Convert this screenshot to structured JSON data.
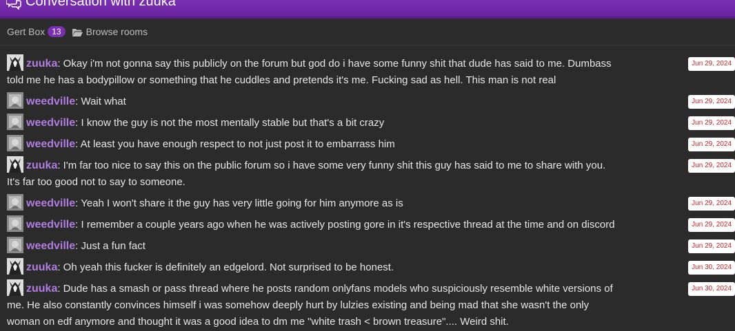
{
  "header": {
    "title": "Conversation with zuuka",
    "icon": "chat-bubbles-icon"
  },
  "subnav": {
    "box_label": "Gert Box",
    "box_count": "13",
    "browse_label": "Browse rooms",
    "browse_icon": "folder-open-icon"
  },
  "colors": {
    "header": "#7a2fb0",
    "username": "#b07ce0",
    "timestamp_text": "#cc2222",
    "background": "#2b2b2b"
  },
  "messages": [
    {
      "user": "zuuka",
      "avatar": "zuuka",
      "text": ": Okay i'm not gonna say this publicly on the forum but god do i have some funny shit that dude has said to me. Dumbass told me he has a bodypillow or something that he cuddles and pretends it's me. Fucking sad as hell. This man is not real",
      "time": "Jun 29, 2024"
    },
    {
      "user": "weedville",
      "avatar": "weedville",
      "text": ": Wait what",
      "time": "Jun 29, 2024"
    },
    {
      "user": "weedville",
      "avatar": "weedville",
      "text": ": I know the guy is not the most mentally stable but that's a bit crazy",
      "time": "Jun 29, 2024"
    },
    {
      "user": "weedville",
      "avatar": "weedville",
      "text": ": At least you have enough respect to not just post it to embarrass him",
      "time": "Jun 29, 2024"
    },
    {
      "user": "zuuka",
      "avatar": "zuuka",
      "text": ": I'm far too nice to say this on the public forum so i have some very funny shit this guy has said to me to share with you. It's far too good not to say to someone.",
      "time": "Jun 29, 2024"
    },
    {
      "user": "weedville",
      "avatar": "weedville",
      "text": ": Yeah I won't share it the guy has very little going for him anymore as is",
      "time": "Jun 29, 2024"
    },
    {
      "user": "weedville",
      "avatar": "weedville",
      "text": ": I remember a couple years ago when he was actively posting gore in it's respective thread at the time and on discord",
      "time": "Jun 29, 2024"
    },
    {
      "user": "weedville",
      "avatar": "weedville",
      "text": ": Just a fun fact",
      "time": "Jun 29, 2024"
    },
    {
      "user": "zuuka",
      "avatar": "zuuka",
      "text": ": Oh yeah this fucker is definitely an edgelord. Not surprised to be honest.",
      "time": "Jun 30, 2024"
    },
    {
      "user": "zuuka",
      "avatar": "zuuka",
      "text": ": Dude has a smash or pass thread where he posts random onlyfans models who suspiciously resemble white versions of me. He also constantly convinces himself i was somehow deeply hurt by lulzies existing and being mad that she wasn't the only woman on edf anymore and thought it was a good idea to dm me \"white trash < brown treasure\".... Weird shit.",
      "time": "Jun 30, 2024"
    }
  ]
}
